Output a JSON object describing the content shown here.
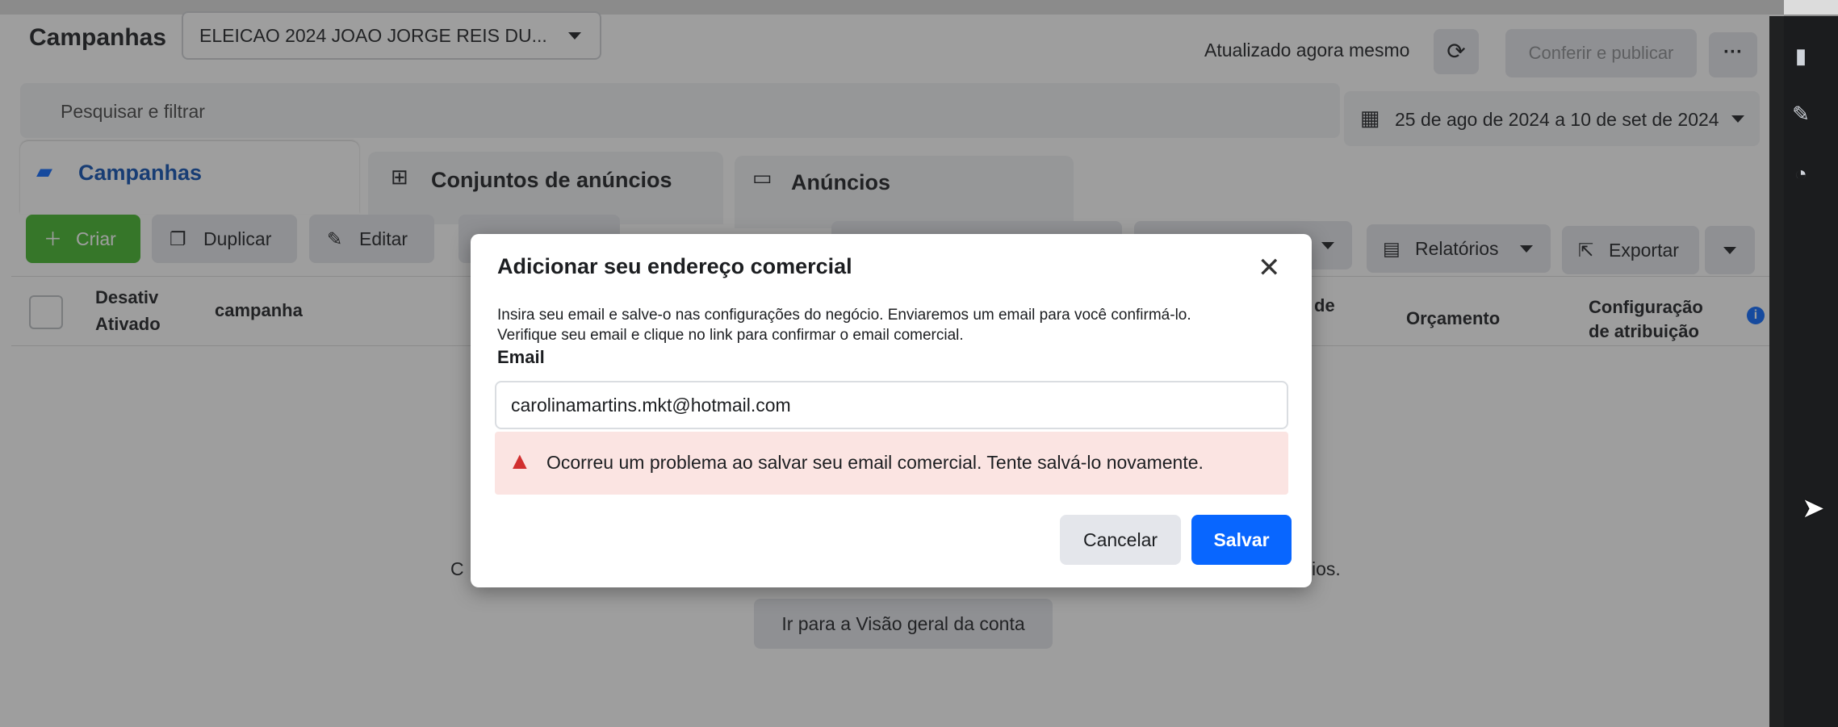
{
  "header": {
    "title": "Campanhas",
    "account": "ELEICAO 2024 JOAO JORGE REIS DU...",
    "updated": "Atualizado agora mesmo",
    "publish": "Conferir e publicar",
    "more": "···"
  },
  "search": {
    "placeholder": "Pesquisar e filtrar"
  },
  "date_range": "25 de ago de 2024 a 10 de set de 2024",
  "tabs": [
    {
      "label": "Campanhas",
      "icon": "folder-icon"
    },
    {
      "label": "Conjuntos de anúncios",
      "icon": "grid-icon"
    },
    {
      "label": "Anúncios",
      "icon": "window-icon"
    }
  ],
  "toolbar": {
    "create": "Criar",
    "duplicate": "Duplicar",
    "edit": "Editar",
    "reports": "Relatórios",
    "export": "Exportar"
  },
  "table": {
    "col_toggle_line1": "Desativ",
    "col_toggle_line2": "Ativado",
    "col_campaign": "campanha",
    "col_partial": "de",
    "col_budget": "Orçamento",
    "col_attr_line1": "Configuração",
    "col_attr_line2": "de atribuição"
  },
  "empty_state": {
    "left_fragment": "C",
    "right_fragment": "ios.",
    "overview_button": "Ir para a Visão geral da conta"
  },
  "modal": {
    "title": "Adicionar seu endereço comercial",
    "desc_line1": "Insira seu email e salve-o nas configurações do negócio. Enviaremos um email para você confirmá-lo.",
    "desc_line2": "Verifique seu email e clique no link para confirmar o email comercial.",
    "email_label": "Email",
    "email_value": "carolinamartins.mkt@hotmail.com",
    "error": "Ocorreu um problema ao salvar seu email comercial. Tente salvá-lo novamente.",
    "cancel": "Cancelar",
    "save": "Salvar"
  },
  "colors": {
    "primary": "#0866ff",
    "create_green": "#42b72a",
    "error_bg": "#fbe4e2",
    "error_icon": "#d12f2f"
  }
}
